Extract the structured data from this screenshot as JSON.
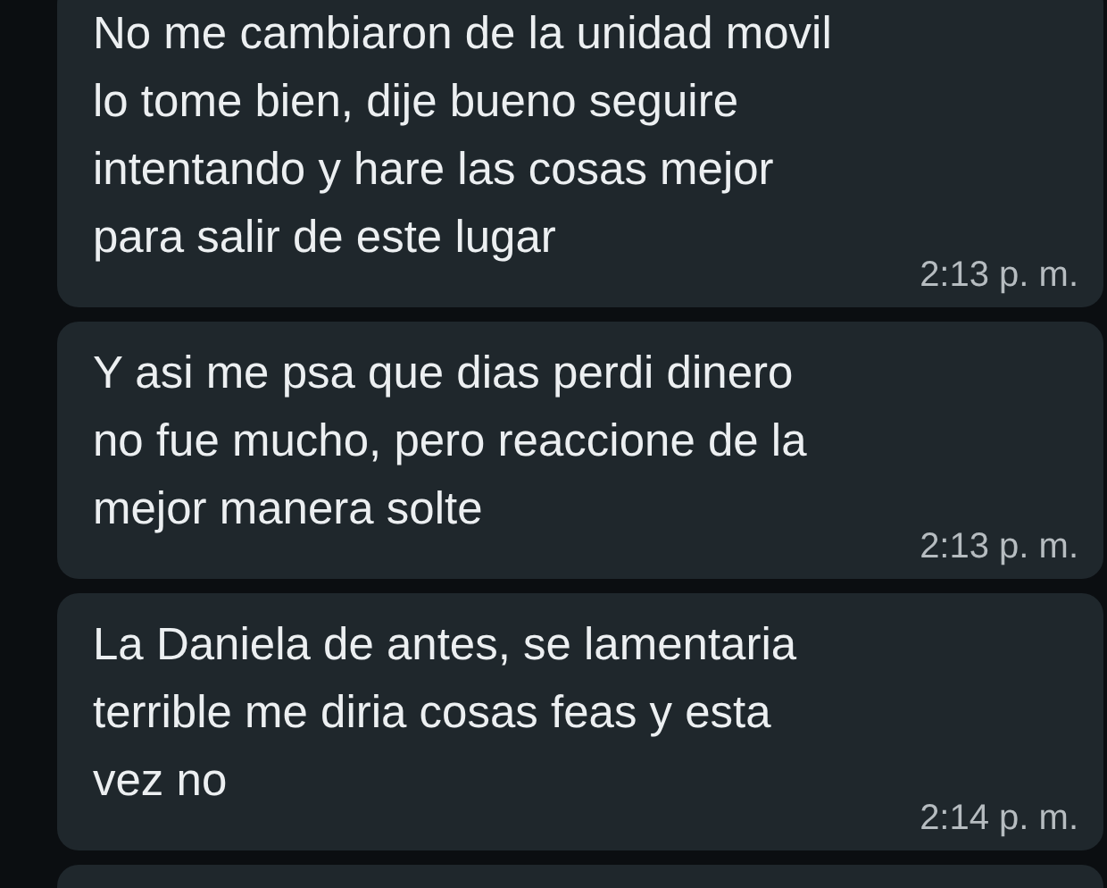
{
  "messages": [
    {
      "lines": [
        "No me cambiaron de la unidad movil",
        "lo tome bien, dije bueno seguire",
        "intentando y hare las cosas mejor",
        "para salir de este lugar"
      ],
      "time": "2:13 p. m."
    },
    {
      "lines": [
        "Y asi me psa que dias perdi dinero",
        "no fue mucho, pero reaccione de la",
        "mejor manera solte"
      ],
      "time": "2:13 p. m."
    },
    {
      "lines": [
        "La Daniela de antes, se lamentaria",
        "terrible me diria cosas feas y esta",
        "vez no"
      ],
      "time": "2:14 p. m."
    }
  ]
}
